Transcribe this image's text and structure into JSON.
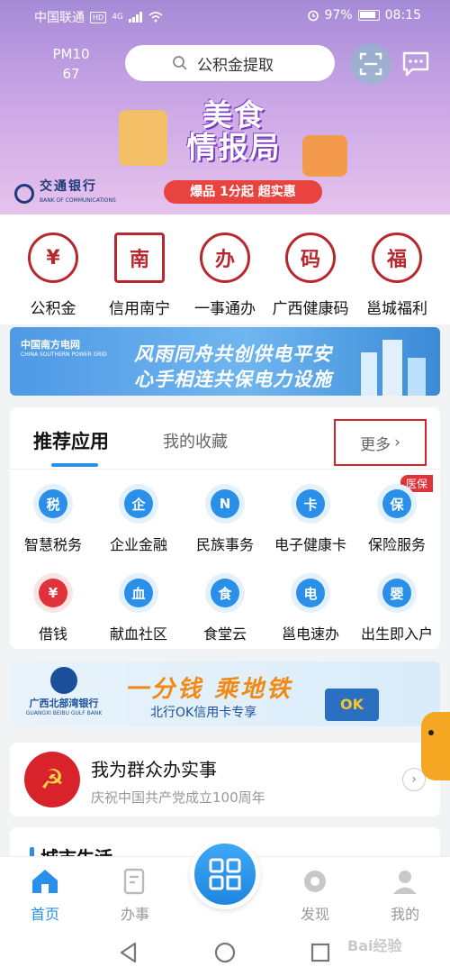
{
  "status_bar": {
    "carrier": "中国联通",
    "hd": "HD",
    "network": "4G",
    "battery": "97%",
    "time": "08:15"
  },
  "header": {
    "weather_line1": "PM10",
    "weather_line2": "67",
    "search_placeholder": "公积金提取"
  },
  "promo_banner": {
    "title_line1": "美食",
    "title_line2": "情报局",
    "subtitle": "爆品 1分起 超实惠",
    "bank_name": "交通银行",
    "bank_name_en": "BANK OF COMMUNICATIONS"
  },
  "quick_services": [
    {
      "label": "公积金",
      "glyph": "¥",
      "icon": "housing-fund-icon"
    },
    {
      "label": "信用南宁",
      "glyph": "南",
      "icon": "credit-nanning-icon"
    },
    {
      "label": "一事通办",
      "glyph": "办",
      "icon": "one-stop-service-icon"
    },
    {
      "label": "广西健康码",
      "glyph": "码",
      "icon": "health-code-icon"
    },
    {
      "label": "邕城福利",
      "glyph": "福",
      "icon": "city-welfare-icon"
    }
  ],
  "grid_banner": {
    "logo_line1": "中国南方电网",
    "logo_line2": "CHINA SOUTHERN POWER GRID",
    "line1": "风雨同舟共创供电平安",
    "line2": "心手相连共保电力设施"
  },
  "apps_section": {
    "tab_recommended": "推荐应用",
    "tab_favorites": "我的收藏",
    "more": "更多",
    "medical_badge": "医保",
    "apps": [
      {
        "label": "智慧税务",
        "glyph": "税",
        "icon": "tax-icon",
        "tone": "blue"
      },
      {
        "label": "企业金融",
        "glyph": "企",
        "icon": "enterprise-finance-icon",
        "tone": "blue"
      },
      {
        "label": "民族事务",
        "glyph": "N",
        "icon": "ethnic-affairs-icon",
        "tone": "blue"
      },
      {
        "label": "电子健康卡",
        "glyph": "卡",
        "icon": "health-card-icon",
        "tone": "blue"
      },
      {
        "label": "保险服务",
        "glyph": "保",
        "icon": "insurance-icon",
        "tone": "blue"
      },
      {
        "label": "借钱",
        "glyph": "¥",
        "icon": "borrow-money-icon",
        "tone": "red"
      },
      {
        "label": "献血社区",
        "glyph": "血",
        "icon": "blood-donation-icon",
        "tone": "blue"
      },
      {
        "label": "食堂云",
        "glyph": "食",
        "icon": "canteen-icon",
        "tone": "blue"
      },
      {
        "label": "邕电速办",
        "glyph": "电",
        "icon": "electric-service-icon",
        "tone": "blue"
      },
      {
        "label": "出生即入户",
        "glyph": "婴",
        "icon": "birth-registration-icon",
        "tone": "blue"
      }
    ]
  },
  "metro_banner": {
    "bank_cn": "广西北部湾银行",
    "bank_en": "GUANGXI BEIBU GULF BANK",
    "headline": "一分钱 乘地铁",
    "sub": "北行OK信用卡专享",
    "card_text": "OK"
  },
  "party_card": {
    "title": "我为群众办实事",
    "subtitle": "庆祝中国共产党成立100周年"
  },
  "city_section": {
    "title": "城市生活"
  },
  "tabbar": {
    "items": [
      {
        "label": "首页",
        "icon": "home-icon",
        "active": true
      },
      {
        "label": "办事",
        "icon": "tasks-icon",
        "active": false
      },
      {
        "label": "发现",
        "icon": "discover-icon",
        "active": false
      },
      {
        "label": "我的",
        "icon": "profile-icon",
        "active": false
      }
    ]
  },
  "watermark": "Bai经验",
  "colors": {
    "primary": "#2a8fe8",
    "accent_red": "#d8232a",
    "banner_purple": "#a58ad6"
  }
}
